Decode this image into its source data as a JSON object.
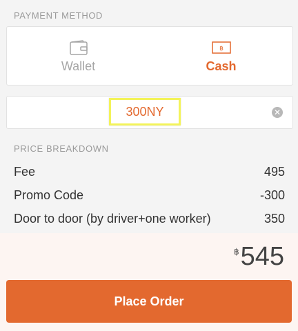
{
  "payment_method": {
    "section_label": "PAYMENT METHOD",
    "options": [
      {
        "label": "Wallet",
        "icon": "wallet-icon",
        "selected": false
      },
      {
        "label": "Cash",
        "icon": "cash-icon",
        "selected": true
      }
    ]
  },
  "promo": {
    "value": "300NY",
    "clear_icon": "clear-icon"
  },
  "price_breakdown": {
    "section_label": "PRICE BREAKDOWN",
    "rows": [
      {
        "label": "Fee",
        "value": "495"
      },
      {
        "label": "Promo Code",
        "value": "-300"
      },
      {
        "label": "Door to door (by driver+one worker)",
        "value": "350"
      }
    ]
  },
  "total": {
    "currency": "฿",
    "amount": "545"
  },
  "place_order": {
    "label": "Place Order"
  },
  "colors": {
    "accent": "#e3692f",
    "highlight": "#f3f35a",
    "muted": "#a6a6a6"
  }
}
